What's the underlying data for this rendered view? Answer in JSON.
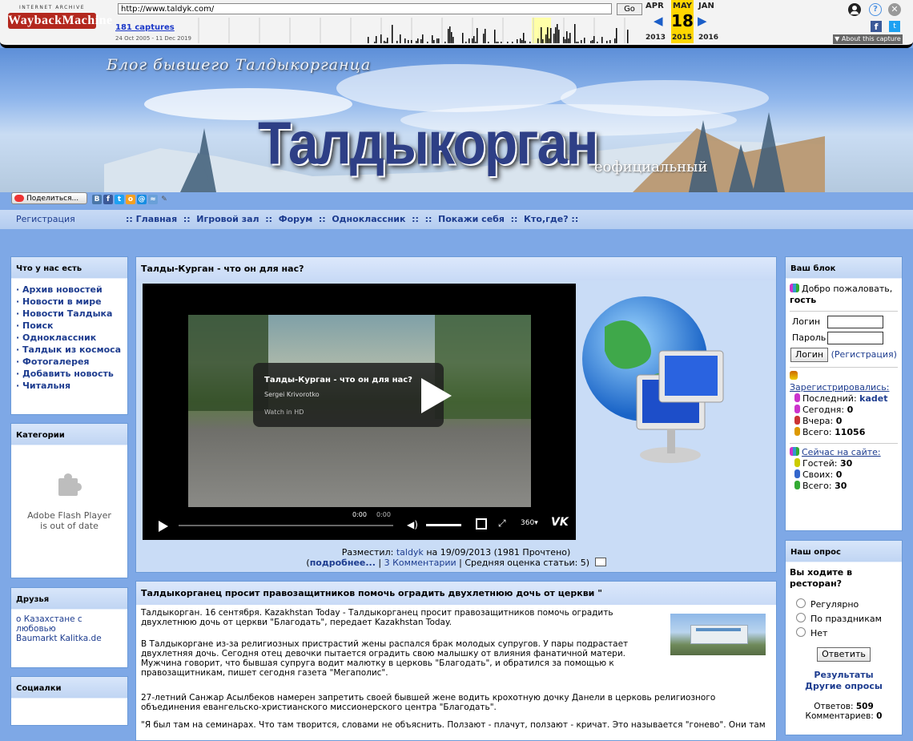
{
  "wayback": {
    "logo_top": "INTERNET ARCHIVE",
    "logo_main": "WaybackMachine",
    "url": "http://www.taldyk.com/",
    "go_label": "Go",
    "captures_label": "181 captures",
    "date_range": "24 Oct 2005 - 11 Dec 2019",
    "prev_month": "APR",
    "cur_month": "MAY",
    "next_month": "JAN",
    "day": "18",
    "prev_year": "2013",
    "cur_year": "2015",
    "next_year": "2016",
    "about_label": "▼ About this capture"
  },
  "banner": {
    "blog_title": "Блог бывшего Талдыкорганца",
    "site_title": "Талдыкорган",
    "subtitle": "еофициальный"
  },
  "share": {
    "label": "Поделиться..."
  },
  "nav": {
    "register": "Регистрация",
    "links": ":: Главная  ::  Игровой зал  ::  Форум  ::  Одноклассник  ::  ::  Покажи себя  ::  Кто,где? ::"
  },
  "left": {
    "have_title": "Что у нас есть",
    "have_items": [
      "Архив новостей",
      "Новости в мире",
      "Новости Талдыка",
      "Поиск",
      "Одноклассник",
      "Талдык из космоса",
      "Фотогалерея",
      "Добавить новость",
      "Читальня"
    ],
    "cats_title": "Категории",
    "flash_line1": "Adobe Flash Player",
    "flash_line2": "is out of date",
    "friends_title": "Друзья",
    "friends_link1": "о Казахстане с любовью",
    "friends_link2": "Baumarkt Kalitka.de",
    "social_title": "Социалки"
  },
  "article1": {
    "title": "Талды-Курган - что он для нас?",
    "video_title": "Талды-Курган - что он для нас?",
    "video_author": "Sergei Krivorotko",
    "video_hd": "Watch in HD",
    "time": "0:00",
    "time2": "0:00",
    "quality": "360",
    "posted_prefix": "Разместил:",
    "author": "taldyk",
    "posted_on": "на 19/09/2013 (1981 Прочтено)",
    "more": "подробнее...",
    "comments": "3 Комментарии",
    "rating": "Средняя оценка статьи: 5)"
  },
  "article2": {
    "title": "Талдыкорганец просит правозащитников помочь оградить двухлетнюю дочь от церкви \"",
    "p1": "Талдыкорган. 16 сентября. Kazakhstan Today - Талдыкорганец просит правозащитников помочь оградить двухлетнюю дочь от церкви \"Благодать\", передает Kazakhstan Today.",
    "p2": "В Талдыкоргане из-за религиозных пристрастий жены распался брак молодых супругов. У пары подрастает двухлетняя дочь. Сегодня отец девочки пытается оградить свою малышку от влияния фанатичной матери. Мужчина говорит, что бывшая супруга водит малютку в церковь \"Благодать\", и обратился за помощью к правозащитникам, пишет сегодня газета \"Мегаполис\".",
    "p3": "27-летний Санжар Асылбеков намерен запретить своей бывшей жене водить крохотную дочку Данели в церковь религиозного объединения евангельско-христианского миссионерского центра \"Благодать\".",
    "p4": "\"Я был там на семинарах. Что там творится, словами не объяснить. Ползают - плачут, ползают - кричат. Это называется \"гонево\". Они там"
  },
  "right": {
    "block_title": "Ваш блок",
    "welcome": "Добро пожаловать,",
    "guest": "гость",
    "login_label": "Логин",
    "password_label": "Пароль",
    "login_button": "Логин",
    "register_link": "(Регистрация)",
    "registered": "Зарегистрировались:",
    "last_label": "Последний:",
    "last_value": "kadet",
    "today_label": "Сегодня:",
    "today_value": "0",
    "yesterday_label": "Вчера:",
    "yesterday_value": "0",
    "total_label": "Всего:",
    "total_value": "11056",
    "online": "Сейчас на сайте:",
    "guests_label": "Гостей:",
    "guests_value": "30",
    "own_label": "Своих:",
    "own_value": "0",
    "online_total_label": "Всего:",
    "online_total_value": "30",
    "poll_title": "Наш опрос",
    "poll_question": "Вы ходите в ресторан?",
    "poll_options": [
      "Регулярно",
      "По праздникам",
      "Нет"
    ],
    "poll_button": "Ответить",
    "results": "Результаты",
    "other_polls": "Другие опросы",
    "answers_label": "Ответов:",
    "answers_value": "509",
    "comments_label": "Комментариев:",
    "comments_value": "0"
  }
}
